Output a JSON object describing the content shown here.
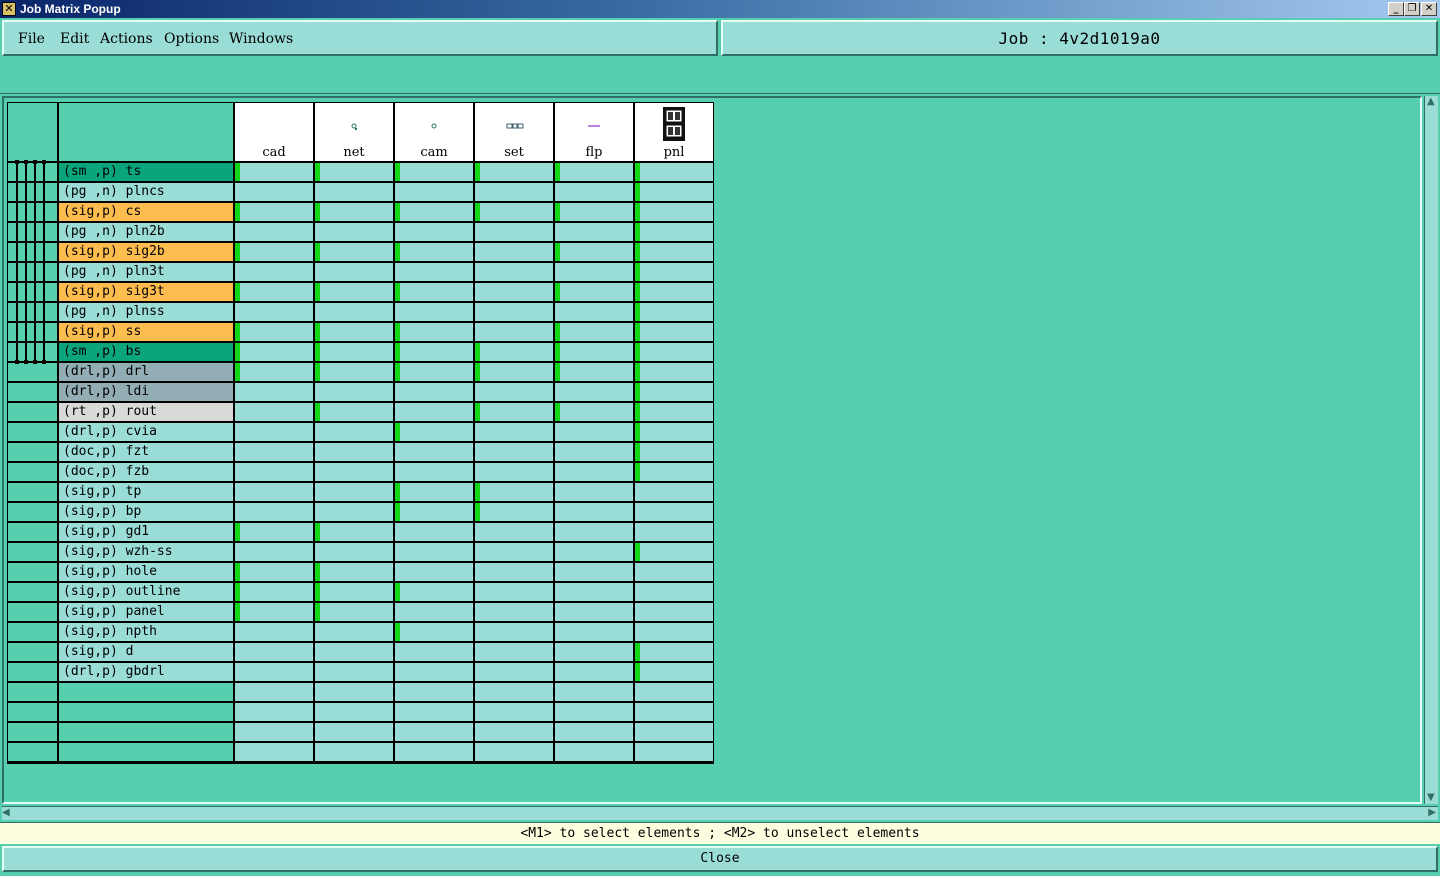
{
  "window": {
    "title": "Job Matrix Popup"
  },
  "menu": [
    "File",
    "Edit",
    "Actions",
    "Options",
    "Windows"
  ],
  "job_label": "Job  :  4v2d1019a0",
  "colors": {
    "sm": "#0aa57a",
    "pg": "#9adcd6",
    "sig_sel": "#fdbd4e",
    "drl_sel": "#92adb3",
    "rt_sel": "#d9d9d9",
    "plain": "#9adcd6",
    "board_mark": "#11d618"
  },
  "columns": [
    {
      "label": "cad",
      "icon": ""
    },
    {
      "label": "net",
      "icon": "net-dot-icon"
    },
    {
      "label": "cam",
      "icon": "cam-dot-icon"
    },
    {
      "label": "set",
      "icon": "set-chain-icon"
    },
    {
      "label": "flp",
      "icon": "flp-dash-icon"
    },
    {
      "label": "pnl",
      "icon": "panel-icon"
    }
  ],
  "rows": [
    {
      "name": "(sm ,p) ts",
      "style": "sm",
      "marks": [
        1,
        1,
        1,
        1,
        1,
        1
      ]
    },
    {
      "name": "(pg ,n) plncs",
      "style": "pg",
      "marks": [
        0,
        0,
        0,
        0,
        0,
        1
      ]
    },
    {
      "name": "(sig,p) cs",
      "style": "sig",
      "marks": [
        1,
        1,
        1,
        1,
        1,
        1
      ]
    },
    {
      "name": "(pg ,n) pln2b",
      "style": "pg",
      "marks": [
        0,
        0,
        0,
        0,
        0,
        1
      ]
    },
    {
      "name": "(sig,p) sig2b",
      "style": "sig",
      "marks": [
        1,
        1,
        1,
        0,
        1,
        1
      ]
    },
    {
      "name": "(pg ,n) pln3t",
      "style": "pg",
      "marks": [
        0,
        0,
        0,
        0,
        0,
        1
      ]
    },
    {
      "name": "(sig,p) sig3t",
      "style": "sig",
      "marks": [
        1,
        1,
        1,
        0,
        1,
        1
      ]
    },
    {
      "name": "(pg ,n) plnss",
      "style": "pg",
      "marks": [
        0,
        0,
        0,
        0,
        0,
        1
      ]
    },
    {
      "name": "(sig,p) ss",
      "style": "sig",
      "marks": [
        1,
        1,
        1,
        0,
        1,
        1
      ]
    },
    {
      "name": "(sm ,p) bs",
      "style": "sm",
      "marks": [
        1,
        1,
        1,
        1,
        1,
        1
      ]
    },
    {
      "name": "(drl,p) drl",
      "style": "drl",
      "marks": [
        1,
        1,
        1,
        1,
        1,
        1
      ]
    },
    {
      "name": "(drl,p) ldi",
      "style": "drl",
      "marks": [
        0,
        0,
        0,
        0,
        0,
        1
      ]
    },
    {
      "name": "(rt ,p) rout",
      "style": "rt",
      "marks": [
        0,
        1,
        0,
        1,
        1,
        1
      ]
    },
    {
      "name": "(drl,p) cvia",
      "style": "plain",
      "marks": [
        0,
        0,
        1,
        0,
        0,
        1
      ]
    },
    {
      "name": "(doc,p) fzt",
      "style": "plain",
      "marks": [
        0,
        0,
        0,
        0,
        0,
        1
      ]
    },
    {
      "name": "(doc,p) fzb",
      "style": "plain",
      "marks": [
        0,
        0,
        0,
        0,
        0,
        1
      ]
    },
    {
      "name": "(sig,p) tp",
      "style": "plain",
      "marks": [
        0,
        0,
        1,
        1,
        0,
        0
      ]
    },
    {
      "name": "(sig,p) bp",
      "style": "plain",
      "marks": [
        0,
        0,
        1,
        1,
        0,
        0
      ]
    },
    {
      "name": "(sig,p) gd1",
      "style": "plain",
      "marks": [
        1,
        1,
        0,
        0,
        0,
        0
      ]
    },
    {
      "name": "(sig,p) wzh-ss",
      "style": "plain",
      "marks": [
        0,
        0,
        0,
        0,
        0,
        1
      ]
    },
    {
      "name": "(sig,p) hole",
      "style": "plain",
      "marks": [
        1,
        1,
        0,
        0,
        0,
        0
      ]
    },
    {
      "name": "(sig,p) outline",
      "style": "plain",
      "marks": [
        1,
        1,
        1,
        0,
        0,
        0
      ]
    },
    {
      "name": "(sig,p) panel",
      "style": "plain",
      "marks": [
        1,
        1,
        0,
        0,
        0,
        0
      ]
    },
    {
      "name": "(sig,p) npth",
      "style": "plain",
      "marks": [
        0,
        0,
        1,
        0,
        0,
        0
      ]
    },
    {
      "name": "(sig,p) d",
      "style": "plain",
      "marks": [
        0,
        0,
        0,
        0,
        0,
        1
      ]
    },
    {
      "name": "(drl,p) gbdrl",
      "style": "plain",
      "marks": [
        0,
        0,
        0,
        0,
        0,
        1
      ]
    },
    {
      "name": "",
      "style": "empty",
      "marks": [
        0,
        0,
        0,
        0,
        0,
        0
      ]
    },
    {
      "name": "",
      "style": "empty",
      "marks": [
        0,
        0,
        0,
        0,
        0,
        0
      ]
    },
    {
      "name": "",
      "style": "empty",
      "marks": [
        0,
        0,
        0,
        0,
        0,
        0
      ]
    },
    {
      "name": "",
      "style": "empty",
      "marks": [
        0,
        0,
        0,
        0,
        0,
        0
      ]
    }
  ],
  "hint": "<M1> to select elements ; <M2> to unselect elements",
  "close_label": "Close"
}
